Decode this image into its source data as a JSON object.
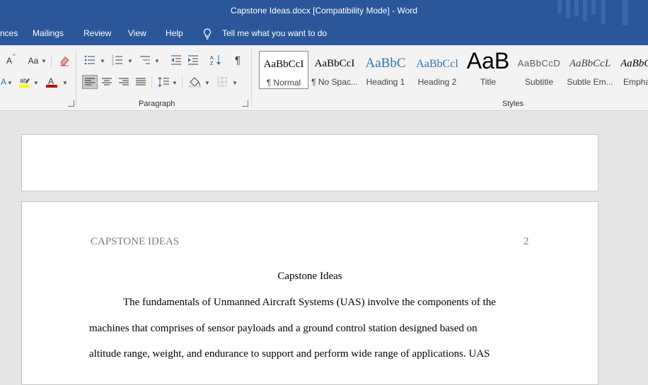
{
  "window": {
    "title": "Capstone Ideas.docx [Compatibility Mode]  -  Word"
  },
  "tabs": [
    "nces",
    "Mailings",
    "Review",
    "View",
    "Help"
  ],
  "tell_me": "Tell me what you want to do",
  "ribbon": {
    "font_group": {
      "grow_label": "A",
      "case_label": "Aa"
    },
    "paragraph_label": "Paragraph",
    "styles_label": "Styles",
    "styles": [
      {
        "sample": "AaBbCcI",
        "name": "¶ Normal"
      },
      {
        "sample": "AaBbCcI",
        "name": "¶ No Spac..."
      },
      {
        "sample": "AaBbC",
        "name": "Heading 1"
      },
      {
        "sample": "AaBbCcl",
        "name": "Heading 2"
      },
      {
        "sample": "AaB",
        "name": "Title"
      },
      {
        "sample": "AaBbCcD",
        "name": "Subtitle"
      },
      {
        "sample": "AaBbCcL",
        "name": "Subtle Em..."
      },
      {
        "sample": "AaBbC",
        "name": "Empha"
      }
    ]
  },
  "document": {
    "running_head": "CAPSTONE IDEAS",
    "page_number": "2",
    "heading": "Capstone Ideas",
    "lines": [
      "The fundamentals of Unmanned Aircraft Systems (UAS) involve the components of the",
      "machines that comprises of sensor payloads and a ground control station designed based on",
      "altitude range, weight, and endurance to support and perform wide range of applications. UAS"
    ]
  },
  "colors": {
    "title_bar": "#2b579a",
    "highlight": "#ffff00",
    "font_color": "#c00000",
    "heading_blue": "#2e74b5"
  }
}
